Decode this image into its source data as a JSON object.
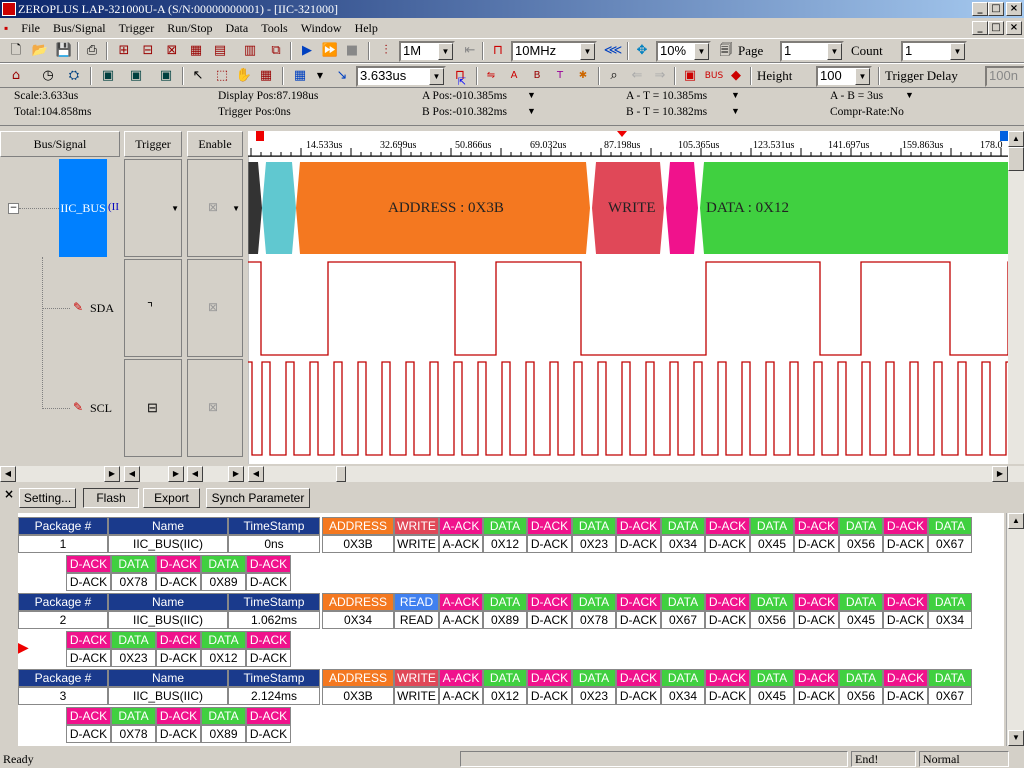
{
  "title": "ZEROPLUS LAP-321000U-A (S/N:00000000001) - [IIC-321000]",
  "menu": [
    "File",
    "Bus/Signal",
    "Trigger",
    "Run/Stop",
    "Data",
    "Tools",
    "Window",
    "Help"
  ],
  "toolbar1": {
    "rate": "1M",
    "freq": "10MHz",
    "zoom": "10%",
    "page_label": "Page",
    "page": "1",
    "count_label": "Count",
    "count": "1"
  },
  "toolbar2": {
    "scale": "3.633us",
    "height_label": "Height",
    "height": "100",
    "trigger_delay_label": "Trigger Delay",
    "trigger_delay": "100n"
  },
  "info": {
    "scale": "Scale:3.633us",
    "total": "Total:104.858ms",
    "display_pos": "Display Pos:87.198us",
    "trigger_pos": "Trigger Pos:0ns",
    "a_pos": "A Pos:-010.385ms",
    "b_pos": "B Pos:-010.382ms",
    "a_t": "A - T = 10.385ms",
    "b_t": "B - T = 10.382ms",
    "a_b": "A - B = 3us",
    "compr": "Compr-Rate:No"
  },
  "columns": {
    "bus_signal": "Bus/Signal",
    "trigger": "Trigger",
    "enable": "Enable"
  },
  "signals": {
    "bus": "IIC_BUS",
    "bus_suffix": "(II",
    "sda": "SDA",
    "scl": "SCL"
  },
  "ruler": [
    "14.533us",
    "32.699us",
    "50.866us",
    "69.032us",
    "87.198us",
    "105.365us",
    "123.531us",
    "141.697us",
    "159.863us",
    "178.0"
  ],
  "bus_labels": {
    "address": "ADDRESS : 0X3B",
    "write": "WRITE",
    "data": "DATA : 0X12"
  },
  "colors": {
    "address": "#f47820",
    "write": "#e04858",
    "ack": "#f0128c",
    "data": "#40d040",
    "read": "#4080f0",
    "teal": "#60c8d0",
    "bus_blue": "#0080ff"
  },
  "panel_buttons": [
    "Setting...",
    "Flash",
    "Export",
    "Synch Parameter"
  ],
  "packet_headers": [
    "Package #",
    "Name",
    "TimeStamp"
  ],
  "packets": [
    {
      "num": "1",
      "name": "IIC_BUS(IIC)",
      "ts": "0ns",
      "row1": [
        [
          "ADDRESS",
          "0X3B"
        ],
        [
          "WRITE",
          "WRITE"
        ],
        [
          "A-ACK",
          "A-ACK"
        ],
        [
          "DATA",
          "0X12"
        ],
        [
          "D-ACK",
          "D-ACK"
        ],
        [
          "DATA",
          "0X23"
        ],
        [
          "D-ACK",
          "D-ACK"
        ],
        [
          "DATA",
          "0X34"
        ],
        [
          "D-ACK",
          "D-ACK"
        ],
        [
          "DATA",
          "0X45"
        ],
        [
          "D-ACK",
          "D-ACK"
        ],
        [
          "DATA",
          "0X56"
        ],
        [
          "D-ACK",
          "D-ACK"
        ],
        [
          "DATA",
          "0X67"
        ]
      ],
      "row2": [
        [
          "D-ACK",
          "D-ACK"
        ],
        [
          "DATA",
          "0X78"
        ],
        [
          "D-ACK",
          "D-ACK"
        ],
        [
          "DATA",
          "0X89"
        ],
        [
          "D-ACK",
          "D-ACK"
        ]
      ]
    },
    {
      "num": "2",
      "name": "IIC_BUS(IIC)",
      "ts": "1.062ms",
      "row1": [
        [
          "ADDRESS",
          "0X34"
        ],
        [
          "READ",
          "READ"
        ],
        [
          "A-ACK",
          "A-ACK"
        ],
        [
          "DATA",
          "0X89"
        ],
        [
          "D-ACK",
          "D-ACK"
        ],
        [
          "DATA",
          "0X78"
        ],
        [
          "D-ACK",
          "D-ACK"
        ],
        [
          "DATA",
          "0X67"
        ],
        [
          "D-ACK",
          "D-ACK"
        ],
        [
          "DATA",
          "0X56"
        ],
        [
          "D-ACK",
          "D-ACK"
        ],
        [
          "DATA",
          "0X45"
        ],
        [
          "D-ACK",
          "D-ACK"
        ],
        [
          "DATA",
          "0X34"
        ]
      ],
      "row2": [
        [
          "D-ACK",
          "D-ACK"
        ],
        [
          "DATA",
          "0X23"
        ],
        [
          "D-ACK",
          "D-ACK"
        ],
        [
          "DATA",
          "0X12"
        ],
        [
          "D-ACK",
          "D-ACK"
        ]
      ]
    },
    {
      "num": "3",
      "name": "IIC_BUS(IIC)",
      "ts": "2.124ms",
      "row1": [
        [
          "ADDRESS",
          "0X3B"
        ],
        [
          "WRITE",
          "WRITE"
        ],
        [
          "A-ACK",
          "A-ACK"
        ],
        [
          "DATA",
          "0X12"
        ],
        [
          "D-ACK",
          "D-ACK"
        ],
        [
          "DATA",
          "0X23"
        ],
        [
          "D-ACK",
          "D-ACK"
        ],
        [
          "DATA",
          "0X34"
        ],
        [
          "D-ACK",
          "D-ACK"
        ],
        [
          "DATA",
          "0X45"
        ],
        [
          "D-ACK",
          "D-ACK"
        ],
        [
          "DATA",
          "0X56"
        ],
        [
          "D-ACK",
          "D-ACK"
        ],
        [
          "DATA",
          "0X67"
        ]
      ],
      "row2": [
        [
          "D-ACK",
          "D-ACK"
        ],
        [
          "DATA",
          "0X78"
        ],
        [
          "D-ACK",
          "D-ACK"
        ],
        [
          "DATA",
          "0X89"
        ],
        [
          "D-ACK",
          "D-ACK"
        ]
      ]
    }
  ],
  "status": {
    "ready": "Ready",
    "end": "End!",
    "mode": "Normal"
  }
}
